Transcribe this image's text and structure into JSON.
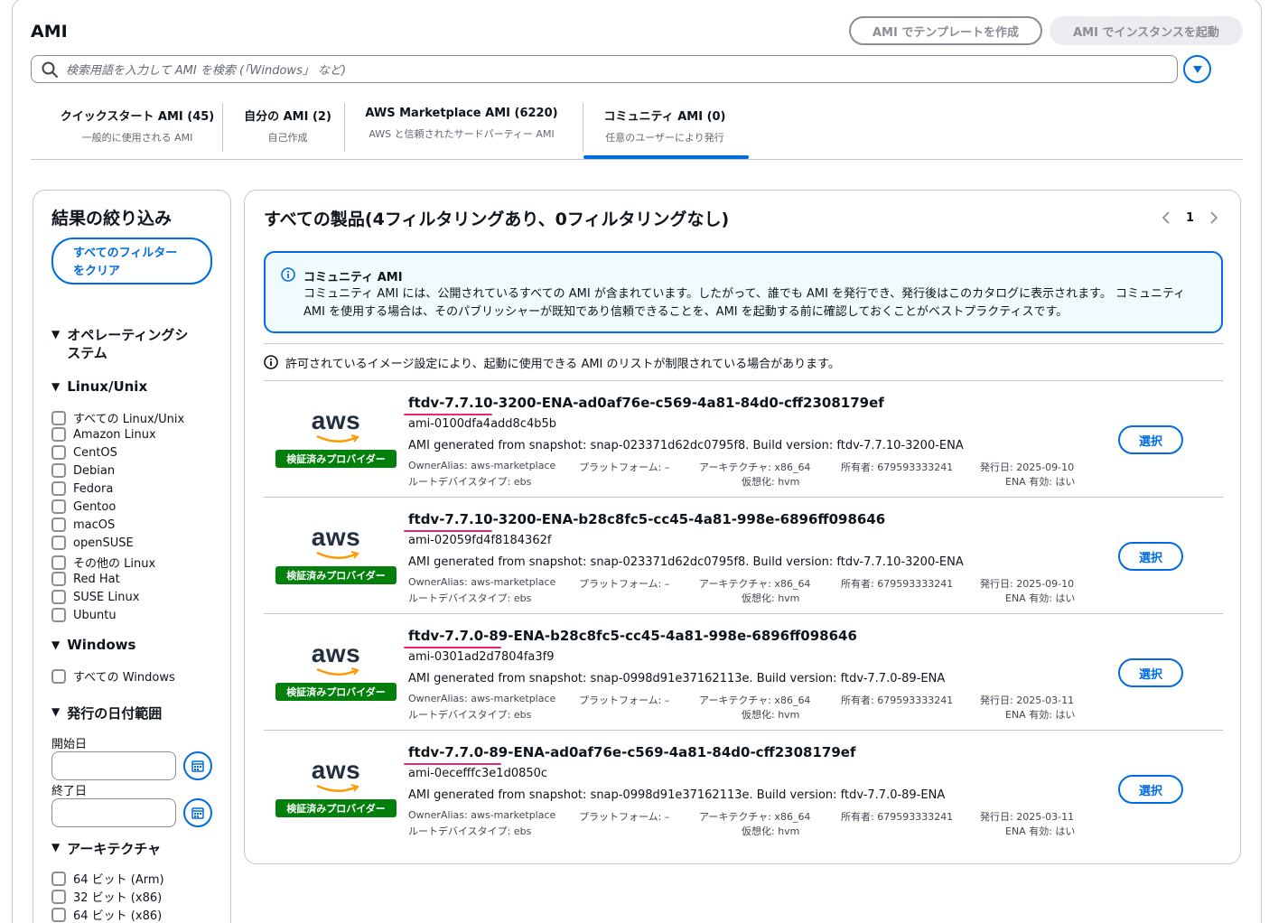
{
  "header": {
    "title": "AMI",
    "btn_template": "AMI でテンプレートを作成",
    "btn_launch": "AMI でインスタンスを起動",
    "search_placeholder": "検索用語を入力して AMI を検索 (「Windows」 など)"
  },
  "tabs": [
    {
      "label": "クイックスタート AMI (45)",
      "sub": "一般的に使用される AMI"
    },
    {
      "label": "自分の AMI (2)",
      "sub": "自己作成"
    },
    {
      "label": "AWS Marketplace AMI (6220)",
      "sub": "AWS と信頼されたサードパーティー AMI"
    },
    {
      "label": "コミュニティ AMI (0)",
      "sub": "任意のユーザーにより発行",
      "active": true
    }
  ],
  "sidebar": {
    "title": "結果の絞り込み",
    "clear_line1": "すべてのフィルター",
    "clear_line2": "をクリア",
    "os_line1": "オペレーティングシ",
    "os_line2": "ステム",
    "linux_head": "Linux/Unix",
    "linux_items": [
      "すべての Linux/Unix",
      "Amazon Linux",
      "CentOS",
      "Debian",
      "Fedora",
      "Gentoo",
      "macOS",
      "openSUSE",
      "その他の Linux",
      "Red Hat",
      "SUSE Linux",
      "Ubuntu"
    ],
    "windows_head": "Windows",
    "windows_items": [
      "すべての Windows"
    ],
    "date_head": "発行の日付範囲",
    "start_label": "開始日",
    "end_label": "終了日",
    "arch_head": "アーキテクチャ",
    "arch_items": [
      "64 ビット (Arm)",
      "32 ビット (x86)",
      "64 ビット (x86)"
    ]
  },
  "main": {
    "title": "すべての製品(4フィルタリングあり、0フィルタリングなし)",
    "page": "1",
    "info_title": "コミュニティ AMI",
    "info_body": "コミュニティ AMI には、公開されているすべての AMI が含まれています。したがって、誰でも AMI を発行でき、発行後はこのカタログに表示されます。 コミュニティ AMI を使用する場合は、そのパブリッシャーが既知であり信頼できることを、AMI を起動する前に確認しておくことがベストプラクティスです。",
    "notice": "許可されているイメージ設定により、起動に使用できる AMI のリストが制限されている場合があります。"
  },
  "common": {
    "logo_text": "aws",
    "badge": "検証済みプロバイダー",
    "select": "選択",
    "owner_alias": "OwnerAlias: aws-marketplace",
    "platform": "プラットフォーム: –",
    "arch": "アーキテクチャ: x86_64",
    "owner": "所有者: 679593333241",
    "root_device": "ルートデバイスタイプ: ebs",
    "virt": "仮想化: hvm",
    "ena": "ENA 有効: はい"
  },
  "results": [
    {
      "name": "ftdv-7.7.10-3200-ENA-ad0af76e-c569-4a81-84d0-cff2308179ef",
      "id": "ami-0100dfa4add8c4b5b",
      "desc": "AMI generated from snapshot: snap-023371d62dc0795f8. Build version: ftdv-7.7.10-3200-ENA",
      "published": "発行日: 2025-09-10"
    },
    {
      "name": "ftdv-7.7.10-3200-ENA-b28c8fc5-cc45-4a81-998e-6896ff098646",
      "id": "ami-02059fd4f8184362f",
      "desc": "AMI generated from snapshot: snap-023371d62dc0795f8. Build version: ftdv-7.7.10-3200-ENA",
      "published": "発行日: 2025-09-10"
    },
    {
      "name": "ftdv-7.7.0-89-ENA-b28c8fc5-cc45-4a81-998e-6896ff098646",
      "id": "ami-0301ad2d7804fa3f9",
      "desc": "AMI generated from snapshot: snap-0998d91e37162113e. Build version: ftdv-7.7.0-89-ENA",
      "published": "発行日: 2025-03-11"
    },
    {
      "name": "ftdv-7.7.0-89-ENA-ad0af76e-c569-4a81-84d0-cff2308179ef",
      "id": "ami-0ecefffc3e1d0850c",
      "desc": "AMI generated from snapshot: snap-0998d91e37162113e. Build version: ftdv-7.7.0-89-ENA",
      "published": "発行日: 2025-03-11"
    }
  ],
  "colors": {
    "accent": "#006ce0",
    "badge_green": "#037f0c",
    "highlight_pink": "#e6257a",
    "info_bg": "#f0fbff"
  }
}
